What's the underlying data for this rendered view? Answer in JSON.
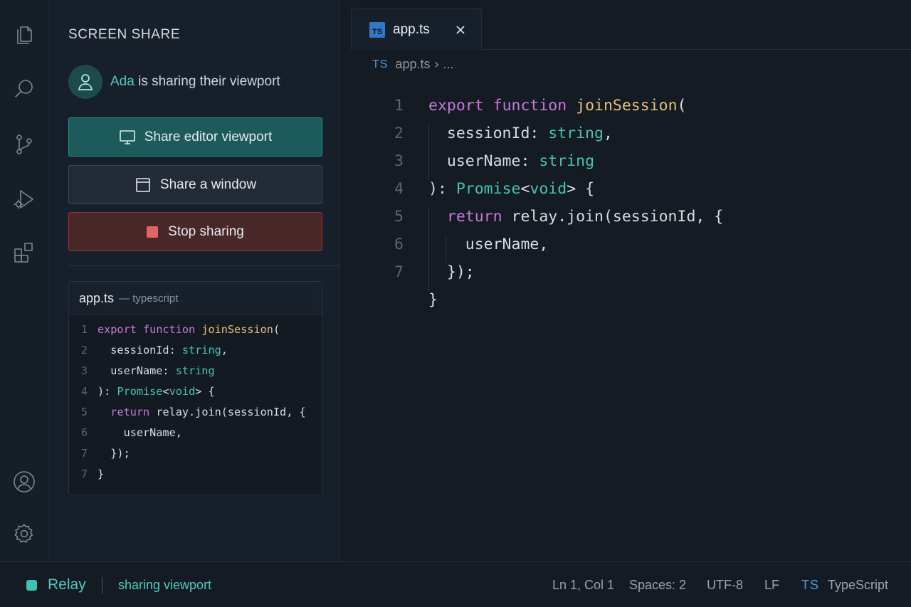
{
  "activity_bar": {
    "icons": [
      "files-icon",
      "search-icon",
      "source-control-icon",
      "run-debug-icon",
      "extensions-icon",
      "account-icon",
      "settings-icon"
    ]
  },
  "sidebar": {
    "title": "SCREEN SHARE",
    "presenter_name": "Ada",
    "presenter_text": " is sharing their viewport",
    "buttons": {
      "share_viewport": "Share editor viewport",
      "share_window": "Share a window",
      "stop_sharing": "Stop sharing"
    },
    "preview": {
      "file": "app.ts",
      "lang": "— typescript",
      "line_numbers": [
        "1",
        "2",
        "3",
        "4",
        "5",
        "6",
        "7",
        "7"
      ]
    }
  },
  "editor": {
    "tab_badge": "TS",
    "tab_label": "app.ts",
    "breadcrumb": {
      "lang": "TS",
      "file": "app.ts",
      "sep": "›",
      "more": "..."
    },
    "line_numbers": [
      "1",
      "2",
      "3",
      "4",
      "5",
      "6",
      "7",
      ""
    ],
    "code_lines": [
      [
        {
          "t": "export",
          "c": "kw"
        },
        {
          "t": " ",
          "c": "pl"
        },
        {
          "t": "function",
          "c": "kw"
        },
        {
          "t": " ",
          "c": "pl"
        },
        {
          "t": "joinSession",
          "c": "fn"
        },
        {
          "t": "(",
          "c": "pl"
        }
      ],
      [
        {
          "t": "  sessionId: ",
          "c": "pl"
        },
        {
          "t": "string",
          "c": "ty"
        },
        {
          "t": ",",
          "c": "pl"
        }
      ],
      [
        {
          "t": "  userName: ",
          "c": "pl"
        },
        {
          "t": "string",
          "c": "ty"
        }
      ],
      [
        {
          "t": "): ",
          "c": "pl"
        },
        {
          "t": "Promise",
          "c": "ty"
        },
        {
          "t": "<",
          "c": "pl"
        },
        {
          "t": "void",
          "c": "ty"
        },
        {
          "t": "> {",
          "c": "pl"
        }
      ],
      [
        {
          "t": "  ",
          "c": "pl"
        },
        {
          "t": "return",
          "c": "kw"
        },
        {
          "t": " relay.join(sessionId, {",
          "c": "pl"
        }
      ],
      [
        {
          "t": "    userName,",
          "c": "pl"
        }
      ],
      [
        {
          "t": "  });",
          "c": "pl"
        }
      ],
      [
        {
          "t": "}",
          "c": "pl"
        }
      ]
    ]
  },
  "status_bar": {
    "app": "Relay",
    "sharing": "sharing viewport",
    "position": "Ln 1, Col 1",
    "spaces": "Spaces: 2",
    "encoding": "UTF-8",
    "eol": "LF",
    "lang_badge": "TS",
    "language": "TypeScript"
  },
  "colors": {
    "accent": "#4fc8bd",
    "keyword": "#c678dd",
    "function": "#e5c07b",
    "type": "#46c1b4",
    "stop": "#e06464",
    "ts_blue": "#3178c6"
  }
}
